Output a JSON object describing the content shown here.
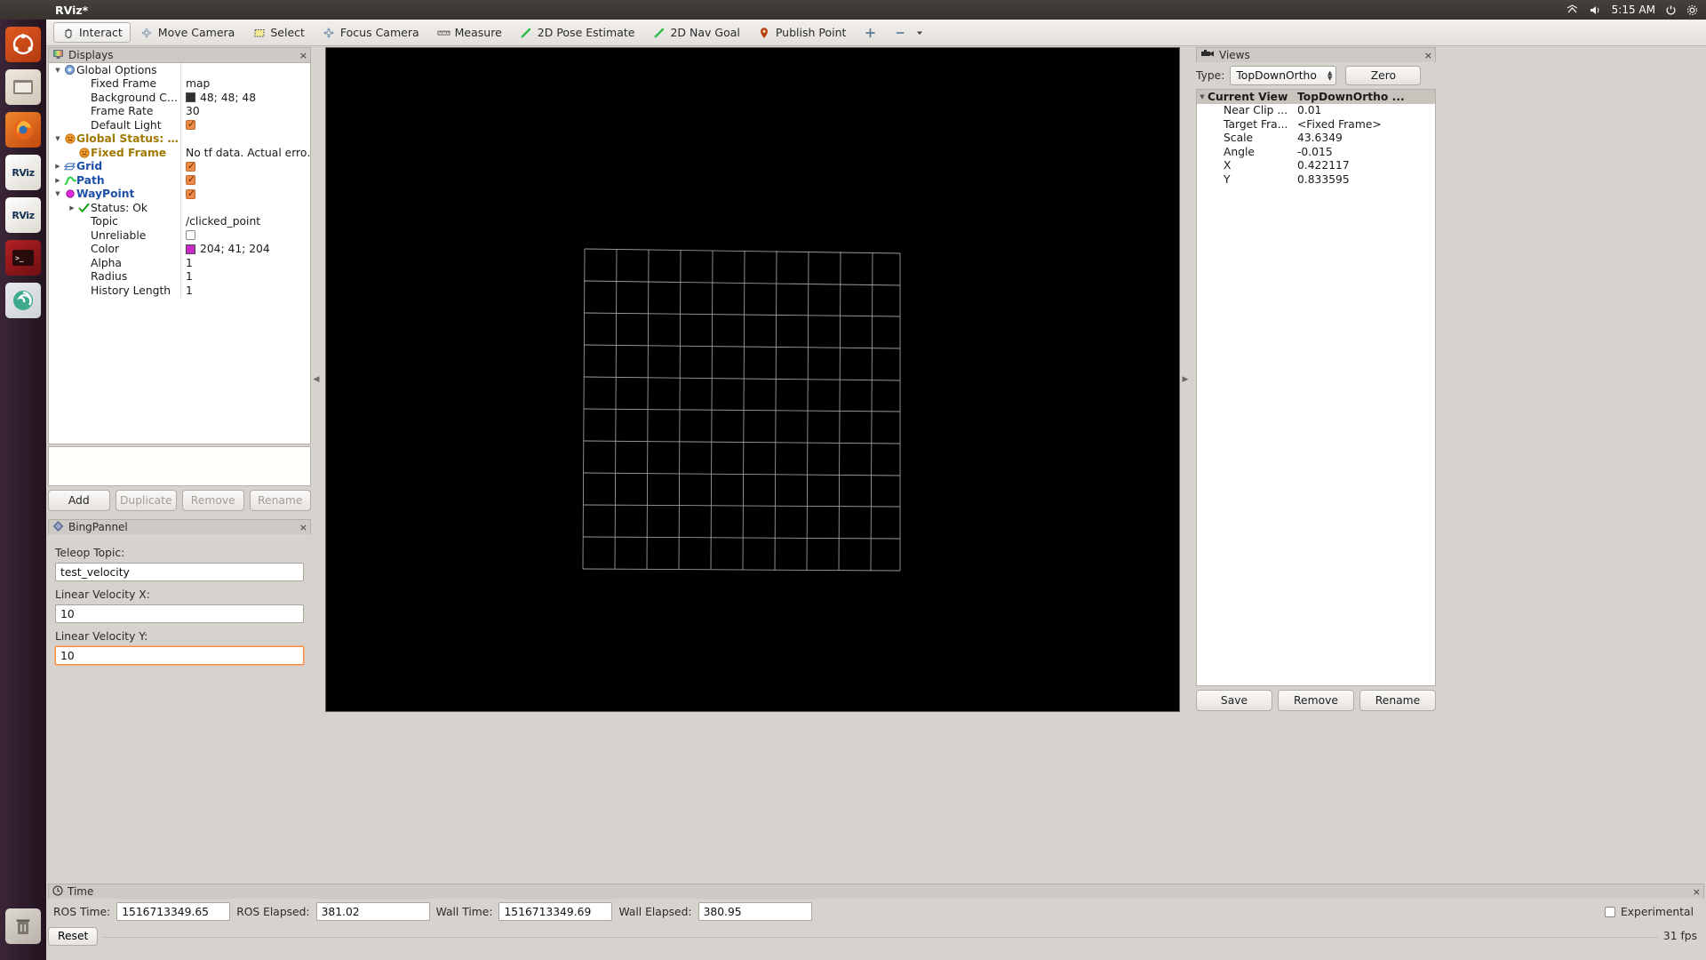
{
  "window": {
    "title": "RViz*"
  },
  "system_bar": {
    "clock": "5:15 AM",
    "indicators": [
      "network-icon",
      "volume-icon",
      "power-icon",
      "gear-icon"
    ]
  },
  "launcher": {
    "items": [
      {
        "name": "ubuntu-dash-icon",
        "glyph": "◉",
        "color": "#dd4814"
      },
      {
        "name": "files-icon",
        "glyph": "▤",
        "color": "#e8e2d8"
      },
      {
        "name": "firefox-icon",
        "glyph": "●",
        "color": "#e86a1c"
      },
      {
        "name": "rviz-icon-1",
        "glyph": "RViz",
        "color": "#f0eee9"
      },
      {
        "name": "rviz-icon-2",
        "glyph": "RViz",
        "color": "#f0eee9"
      },
      {
        "name": "terminal-icon",
        "glyph": "■",
        "color": "#8b1a1a"
      },
      {
        "name": "gazebo-icon",
        "glyph": "◎",
        "color": "#4fc3a1"
      },
      {
        "name": "trash-icon",
        "glyph": "Ὕ1",
        "color": "#d0cbc4"
      }
    ]
  },
  "toolbar": {
    "buttons": [
      {
        "label": "Interact",
        "icon": "hand-cursor-icon",
        "active": true
      },
      {
        "label": "Move Camera",
        "icon": "move-camera-icon",
        "active": false
      },
      {
        "label": "Select",
        "icon": "select-rect-icon",
        "active": false
      },
      {
        "label": "Focus Camera",
        "icon": "focus-camera-icon",
        "active": false
      },
      {
        "label": "Measure",
        "icon": "ruler-icon",
        "active": false
      },
      {
        "label": "2D Pose Estimate",
        "icon": "pose-arrow-icon",
        "active": false
      },
      {
        "label": "2D Nav Goal",
        "icon": "nav-goal-arrow-icon",
        "active": false
      },
      {
        "label": "Publish Point",
        "icon": "map-pin-icon",
        "active": false
      }
    ],
    "add_tool_label": "",
    "overflow_label": ""
  },
  "displays": {
    "title": "Displays",
    "title_icon": "monitor-icon",
    "close_label": "×",
    "rows": [
      {
        "indent": 0,
        "arrow": "▼",
        "icon": "gear-icon",
        "label": "Global Options",
        "style": "plain",
        "value_type": "none",
        "value": ""
      },
      {
        "indent": 1,
        "arrow": "",
        "icon": "",
        "label": "Fixed Frame",
        "style": "plain",
        "value_type": "text",
        "value": "map"
      },
      {
        "indent": 1,
        "arrow": "",
        "icon": "",
        "label": "Background Color",
        "style": "plain",
        "value_type": "color",
        "value": "48; 48; 48",
        "color": "#303030"
      },
      {
        "indent": 1,
        "arrow": "",
        "icon": "",
        "label": "Frame Rate",
        "style": "plain",
        "value_type": "text",
        "value": "30"
      },
      {
        "indent": 1,
        "arrow": "",
        "icon": "",
        "label": "Default Light",
        "style": "plain",
        "value_type": "checkbox",
        "value": "checked"
      },
      {
        "indent": 0,
        "arrow": "▼",
        "icon": "warning-icon",
        "label": "Global Status: W...",
        "style": "warn",
        "value_type": "none",
        "value": ""
      },
      {
        "indent": 1,
        "arrow": "",
        "icon": "warning-icon",
        "label": "Fixed Frame",
        "style": "warn",
        "value_type": "text",
        "value": "No tf data.  Actual erro…"
      },
      {
        "indent": 0,
        "arrow": "▶",
        "icon": "grid-icon",
        "label": "Grid",
        "style": "item",
        "value_type": "checkbox",
        "value": "checked"
      },
      {
        "indent": 0,
        "arrow": "▶",
        "icon": "path-icon",
        "label": "Path",
        "style": "item",
        "value_type": "checkbox",
        "value": "checked"
      },
      {
        "indent": 0,
        "arrow": "▼",
        "icon": "waypoint-icon",
        "label": "WayPoint",
        "style": "item",
        "value_type": "checkbox",
        "value": "checked"
      },
      {
        "indent": 1,
        "arrow": "▶",
        "icon": "check-icon",
        "label": "Status: Ok",
        "style": "plain",
        "value_type": "none",
        "value": ""
      },
      {
        "indent": 1,
        "arrow": "",
        "icon": "",
        "label": "Topic",
        "style": "plain",
        "value_type": "text",
        "value": "/clicked_point"
      },
      {
        "indent": 1,
        "arrow": "",
        "icon": "",
        "label": "Unreliable",
        "style": "plain",
        "value_type": "checkbox",
        "value": "unchecked"
      },
      {
        "indent": 1,
        "arrow": "",
        "icon": "",
        "label": "Color",
        "style": "plain",
        "value_type": "color",
        "value": "204; 41; 204",
        "color": "#cc29cc"
      },
      {
        "indent": 1,
        "arrow": "",
        "icon": "",
        "label": "Alpha",
        "style": "plain",
        "value_type": "text",
        "value": "1"
      },
      {
        "indent": 1,
        "arrow": "",
        "icon": "",
        "label": "Radius",
        "style": "plain",
        "value_type": "text",
        "value": "1"
      },
      {
        "indent": 1,
        "arrow": "",
        "icon": "",
        "label": "History Length",
        "style": "plain",
        "value_type": "text",
        "value": "1"
      }
    ],
    "description": "",
    "buttons": [
      {
        "label": "Add",
        "enabled": true
      },
      {
        "label": "Duplicate",
        "enabled": false
      },
      {
        "label": "Remove",
        "enabled": false
      },
      {
        "label": "Rename",
        "enabled": false
      }
    ]
  },
  "bing_panel": {
    "title": "BingPannel",
    "title_icon": "diamond-icon",
    "close_label": "×",
    "fields": [
      {
        "label": "Teleop Topic:",
        "value": "test_velocity",
        "focused": false,
        "name": "teleop-topic-input"
      },
      {
        "label": "Linear Velocity X:",
        "value": "10",
        "focused": false,
        "name": "linear-velocity-x-input"
      },
      {
        "label": "Linear Velocity Y:",
        "value": "10",
        "focused": true,
        "name": "linear-velocity-y-input"
      }
    ]
  },
  "views": {
    "title": "Views",
    "title_icon": "camera-icon",
    "close_label": "×",
    "type_label": "Type:",
    "type_value": "TopDownOrtho",
    "zero_label": "Zero",
    "header": {
      "left": "Current View",
      "right": "TopDownOrtho ..."
    },
    "rows": [
      {
        "label": "Near Clip ...",
        "value": "0.01"
      },
      {
        "label": "Target Fra...",
        "value": "<Fixed Frame>"
      },
      {
        "label": "Scale",
        "value": "43.6349"
      },
      {
        "label": "Angle",
        "value": "-0.015"
      },
      {
        "label": "X",
        "value": "0.422117"
      },
      {
        "label": "Y",
        "value": "0.833595"
      }
    ],
    "buttons": [
      {
        "label": "Save",
        "enabled": true
      },
      {
        "label": "Remove",
        "enabled": true
      },
      {
        "label": "Rename",
        "enabled": true
      }
    ]
  },
  "time_panel": {
    "title": "Time",
    "title_icon": "clock-icon",
    "close_label": "×",
    "fields": [
      {
        "label": "ROS Time:",
        "value": "1516713349.65",
        "name": "ros-time-field"
      },
      {
        "label": "ROS Elapsed:",
        "value": "381.02",
        "name": "ros-elapsed-field"
      },
      {
        "label": "Wall Time:",
        "value": "1516713349.69",
        "name": "wall-time-field"
      },
      {
        "label": "Wall Elapsed:",
        "value": "380.95",
        "name": "wall-elapsed-field"
      }
    ],
    "experimental_label": "Experimental",
    "experimental_checked": false,
    "reset_label": "Reset",
    "fps": "31 fps"
  },
  "viewport": {
    "background_color": "#000000",
    "grid_color": "#b9b7b0",
    "grid_cells": 10,
    "description": "top-down orthographic view of a 10x10 grid"
  }
}
